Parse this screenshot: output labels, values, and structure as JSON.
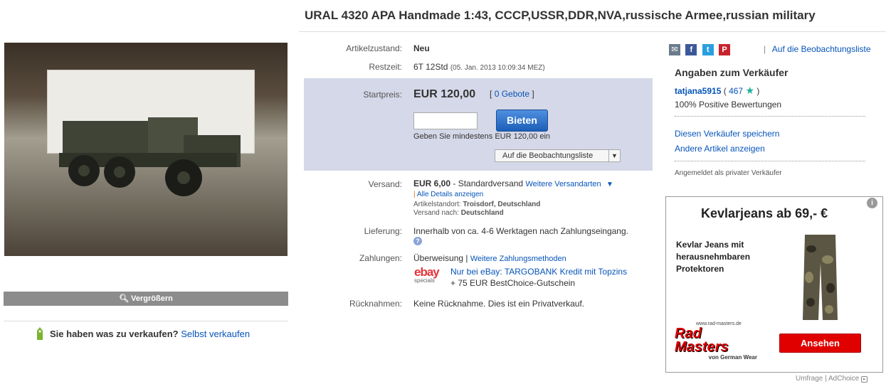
{
  "title": "URAL 4320 APA Handmade 1:43, CCCP,USSR,DDR,NVA,russische Armee,russian military",
  "gallery": {
    "zoom_label": "Vergrößern"
  },
  "sell": {
    "prompt": "Sie haben was zu verkaufen?",
    "link": "Selbst verkaufen"
  },
  "condition": {
    "label": "Artikelzustand:",
    "value": "Neu"
  },
  "remaining": {
    "label": "Restzeit:",
    "value": "6T 12Std",
    "end": "(05. Jan. 2013 10:09:34 MEZ)"
  },
  "bid": {
    "label": "Startpreis:",
    "price": "EUR 120,00",
    "bids_prefix": "[",
    "bids_link": "0 Gebote",
    "bids_suffix": "]",
    "button": "Bieten",
    "hint": "Geben Sie mindestens EUR 120,00 ein",
    "watch_button": "Auf die Beobachtungsliste"
  },
  "shipping": {
    "label": "Versand:",
    "price": "EUR 6,00",
    "method": "- Standardversand",
    "more_link": "Weitere Versandarten",
    "details_link": "Alle Details anzeigen",
    "location_label": "Artikelstandort:",
    "location": "Troisdorf, Deutschland",
    "ships_to_label": "Versand nach:",
    "ships_to": "Deutschland"
  },
  "delivery": {
    "label": "Lieferung:",
    "value": "Innerhalb von ca. 4-6 Werktagen nach Zahlungseingang."
  },
  "payment": {
    "label": "Zahlungen:",
    "value": "Überweisung |",
    "more_link": "Weitere Zahlungsmethoden",
    "ebay_logo": "ebay",
    "ebay_sub": "specials",
    "promo_link": "Nur bei eBay: TARGOBANK Kredit mit Topzins",
    "promo_text": "+ 75 EUR BestChoice-Gutschein"
  },
  "returns": {
    "label": "Rücknahmen:",
    "value": "Keine Rücknahme. Dies ist ein Privatverkauf."
  },
  "share": {
    "watchlist_link": "Auf die Beobachtungsliste"
  },
  "seller": {
    "heading": "Angaben zum Verkäufer",
    "name": "tatjana5915",
    "open": "(",
    "score": "467",
    "close": ")",
    "positive": "100% Positive Bewertungen",
    "save_link": "Diesen Verkäufer speichern",
    "other_link": "Andere Artikel anzeigen",
    "note": "Angemeldet als privater Verkäufer"
  },
  "ad": {
    "title": "Kevlarjeans ab 69,- €",
    "text": "Kevlar Jeans mit herausnehmbaren Protektoren",
    "brand_top": "Rad",
    "brand_bottom": "Masters",
    "brand_url": "www.rad-masters.de",
    "brand_sub": "von German Wear",
    "button": "Ansehen",
    "footer_left": "Umfrage",
    "footer_sep": "|",
    "footer_right": "AdChoice"
  },
  "colors": {
    "link": "#0654ba",
    "bid_box": "#d5d8e8",
    "bid_button": "#1c5fb8",
    "ad_button": "#e10000"
  }
}
